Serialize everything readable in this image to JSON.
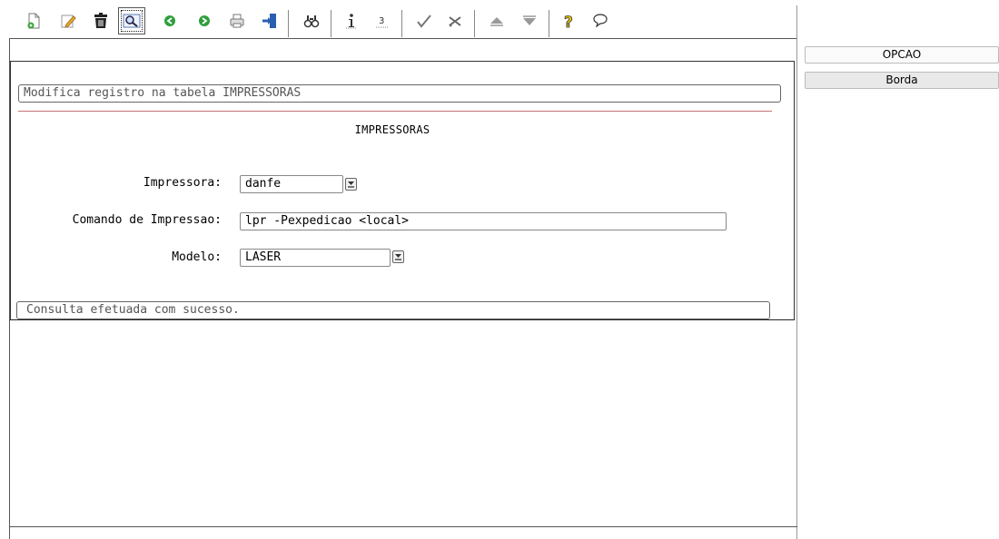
{
  "toolbar": {
    "icons": [
      "new-icon",
      "edit-icon",
      "delete-icon",
      "search-icon",
      "back-icon",
      "forward-icon",
      "print-icon",
      "exit-icon",
      "find-icon",
      "info-icon",
      "page-icon",
      "confirm-icon",
      "cancel-icon",
      "up-icon",
      "down-icon",
      "help-icon",
      "chat-icon"
    ]
  },
  "form": {
    "header_message": "Modifica registro na tabela IMPRESSORAS",
    "title": "IMPRESSORAS",
    "fields": {
      "impressora": {
        "label": "Impressora:",
        "value": "danfe"
      },
      "comando": {
        "label": "Comando de Impressao:",
        "value": "lpr -Pexpedicao <local>"
      },
      "modelo": {
        "label": "Modelo:",
        "value": "LASER"
      }
    },
    "status_message": "Consulta efetuada com sucesso."
  },
  "side": {
    "opcao_label": "OPCAO",
    "borda_label": "Borda"
  },
  "colors": {
    "separator_red": "#c87070",
    "green_arrow": "#2e9e3a",
    "help_yellow": "#e8c400"
  }
}
